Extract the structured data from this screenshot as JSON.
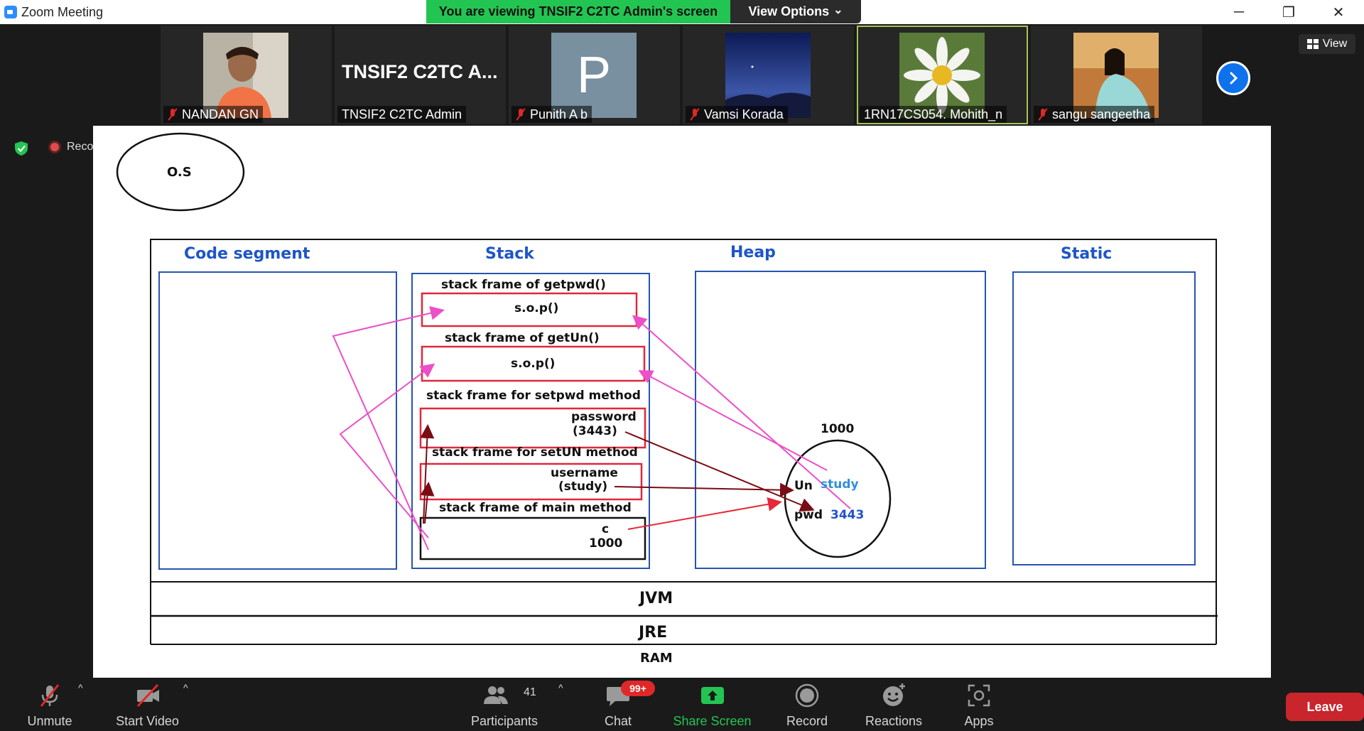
{
  "window": {
    "title": "Zoom Meeting",
    "minimize": "─",
    "restore": "❐",
    "close": "✕"
  },
  "banner": {
    "viewing_text": "You are viewing TNSIF2 C2TC Admin's screen",
    "view_options_label": "View Options",
    "view_options_caret": "⌄"
  },
  "gallery": {
    "view_label": "View",
    "participants": [
      {
        "name": "NANDAN GN",
        "muted": true,
        "active": false
      },
      {
        "name": "TNSIF2 C2TC Admin",
        "avatar_text": "TNSIF2 C2TC A...",
        "muted": false,
        "active": false
      },
      {
        "name": "Punith A b",
        "avatar_letter": "P",
        "muted": true,
        "active": false
      },
      {
        "name": "Vamsi Korada",
        "muted": true,
        "active": false
      },
      {
        "name": "1RN17CS054. Mohith_n",
        "muted": false,
        "active": true
      },
      {
        "name": "sangu sangeetha",
        "muted": true,
        "active": false
      }
    ]
  },
  "overlay": {
    "recording_label": "Reco"
  },
  "diagram": {
    "os": "O.S",
    "segments": {
      "code": "Code segment",
      "stack": "Stack",
      "heap": "Heap",
      "static": "Static"
    },
    "frames": [
      {
        "title": "stack frame of getpwd()",
        "content": "s.o.p()"
      },
      {
        "title": "stack frame of getUn()",
        "content": "s.o.p()"
      },
      {
        "title": "stack frame for setpwd method",
        "content_line1": "password",
        "content_line2": "(3443)"
      },
      {
        "title": "stack frame for setUN method",
        "content_line1": "username",
        "content_line2": "(study)"
      },
      {
        "title": "stack frame of main method",
        "content_line1": "c",
        "content_line2": "1000"
      }
    ],
    "object": {
      "address": "1000",
      "field1_name": "Un",
      "field1_value": "study",
      "field2_name": "pwd",
      "field2_value": "3443"
    },
    "layers": {
      "jvm": "JVM",
      "jre": "JRE",
      "ram": "RAM"
    }
  },
  "toolbar": {
    "unmute": "Unmute",
    "start_video": "Start Video",
    "participants": "Participants",
    "participants_count": "41",
    "chat": "Chat",
    "chat_badge": "99+",
    "share_screen": "Share Screen",
    "record": "Record",
    "reactions": "Reactions",
    "apps": "Apps",
    "leave": "Leave",
    "caret": "^"
  },
  "colors": {
    "banner_green": "#23c552",
    "share_green": "#23c552",
    "leave_red": "#c8252c",
    "segment_blue": "#1e55c7",
    "frame_red": "#e0283c",
    "arrow_pink": "#ec4fc7",
    "arrow_darkred": "#7a0c14",
    "arrow_red": "#e8283a",
    "object_blue": "#2f8fdc"
  }
}
